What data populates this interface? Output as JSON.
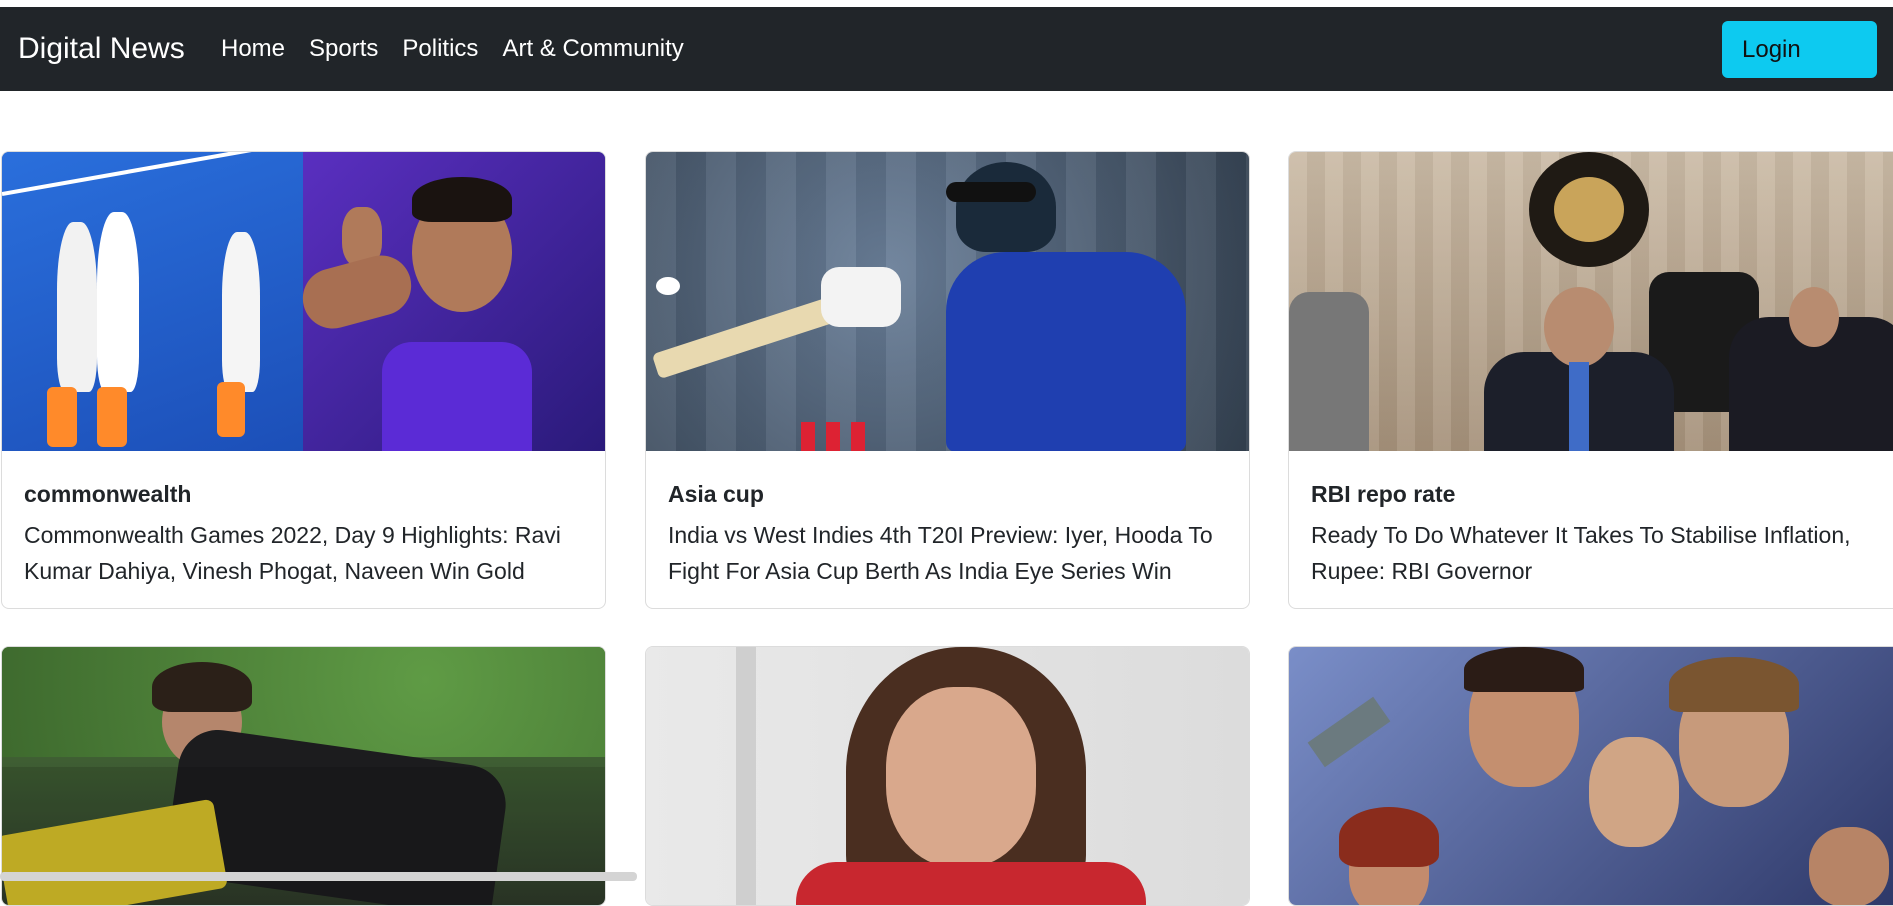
{
  "navbar": {
    "brand": "Digital News",
    "links": [
      "Home",
      "Sports",
      "Politics",
      "Art & Community"
    ],
    "login_label": "Login",
    "background": "#212529",
    "login_color": "#0dcaf0"
  },
  "cards": [
    {
      "title": "commonwealth",
      "text": "Commonwealth Games 2022, Day 9 Highlights: Ravi Kumar Dahiya, Vinesh Phogat, Naveen Win Gold",
      "image": "hockey-and-wrestler-photo"
    },
    {
      "title": "Asia cup",
      "text": "India vs West Indies 4th T20I Preview: Iyer, Hooda To Fight For Asia Cup Berth As India Eye Series Win",
      "image": "cricket-batsman-photo"
    },
    {
      "title": "RBI repo rate",
      "text": "Ready To Do Whatever It Takes To Stabilise Inflation, Rupee: RBI Governor",
      "image": "rbi-press-conference-photo"
    },
    {
      "image": "protest-barricade-photo"
    },
    {
      "image": "actress-portrait-photo"
    },
    {
      "image": "avengers-poster-photo"
    }
  ]
}
